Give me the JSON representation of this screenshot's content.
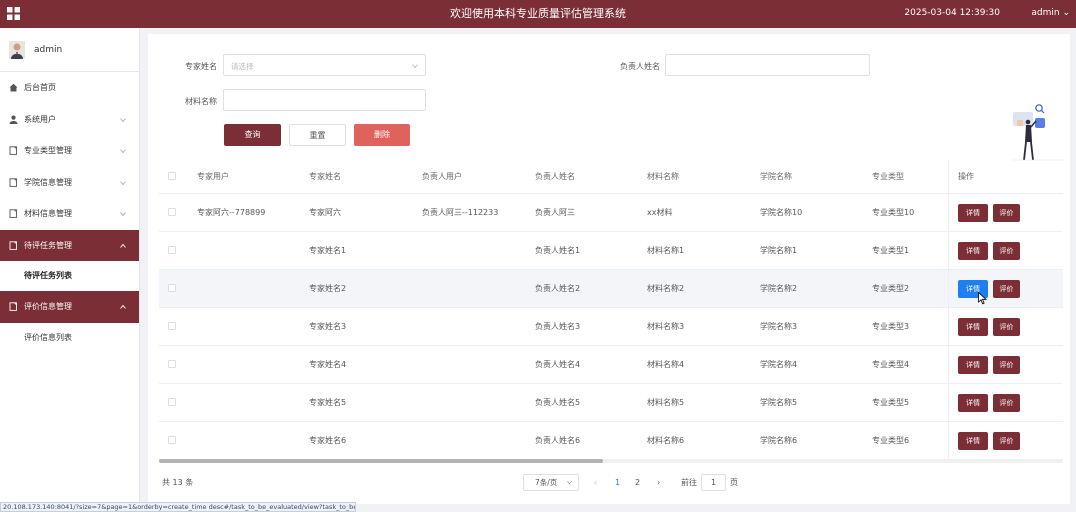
{
  "header": {
    "title": "欢迎使用本科专业质量评估管理系统",
    "datetime": "2025-03-04 12:39:30",
    "user": "admin"
  },
  "sidebar": {
    "user": "admin",
    "items": [
      {
        "label": "后台首页",
        "icon": "home-icon"
      },
      {
        "label": "系统用户",
        "icon": "user-icon",
        "has_chevron": true
      },
      {
        "label": "专业类型管理",
        "icon": "doc-icon",
        "has_chevron": true
      },
      {
        "label": "学院信息管理",
        "icon": "doc-icon",
        "has_chevron": true
      },
      {
        "label": "材料信息管理",
        "icon": "doc-icon",
        "has_chevron": true
      },
      {
        "label": "待评任务管理",
        "icon": "doc-icon",
        "has_chevron": true,
        "active": true
      },
      {
        "label": "待评任务列表",
        "sub": true,
        "bold": true
      },
      {
        "label": "评价信息管理",
        "icon": "doc-icon",
        "has_chevron": true,
        "active": true
      },
      {
        "label": "评价信息列表",
        "sub": true
      }
    ]
  },
  "search": {
    "expert_label": "专家姓名",
    "expert_placeholder": "请选择",
    "leader_label": "负责人姓名",
    "material_label": "材料名称",
    "query_btn": "查询",
    "reset_btn": "重置",
    "delete_btn": "删除"
  },
  "table": {
    "headers": [
      "专家用户",
      "专家姓名",
      "负责人用户",
      "负责人姓名",
      "材料名称",
      "学院名称",
      "专业类型",
      "操作"
    ],
    "detail_label": "详情",
    "eval_label": "评价",
    "rows": [
      [
        "专家阿六--778899",
        "专家阿六",
        "负责人阿三--112233",
        "负责人阿三",
        "xx材料",
        "学院名称10",
        "专业类型10"
      ],
      [
        "",
        "专家姓名1",
        "",
        "负责人姓名1",
        "材料名称1",
        "学院名称1",
        "专业类型1"
      ],
      [
        "",
        "专家姓名2",
        "",
        "负责人姓名2",
        "材料名称2",
        "学院名称2",
        "专业类型2"
      ],
      [
        "",
        "专家姓名3",
        "",
        "负责人姓名3",
        "材料名称3",
        "学院名称3",
        "专业类型3"
      ],
      [
        "",
        "专家姓名4",
        "",
        "负责人姓名4",
        "材料名称4",
        "学院名称4",
        "专业类型4"
      ],
      [
        "",
        "专家姓名5",
        "",
        "负责人姓名5",
        "材料名称5",
        "学院名称5",
        "专业类型5"
      ],
      [
        "",
        "专家姓名6",
        "",
        "负责人姓名6",
        "材料名称6",
        "学院名称6",
        "专业类型6"
      ]
    ],
    "highlight_row": 2
  },
  "pagination": {
    "total": "共 13 条",
    "page_size": "7条/页",
    "pages": [
      "1",
      "2"
    ],
    "current": "1",
    "goto_label": "前往",
    "goto_value": "1",
    "page_unit": "页"
  },
  "status_url": "20.108.173.140:8041/?size=7&page=1&orderby=create_time desc#/task_to_be_evaluated/view?task_to_be ...",
  "colors": {
    "primary": "#7b2e36",
    "accent_blue": "#1e7ff0",
    "delete_red": "#e0625c"
  }
}
